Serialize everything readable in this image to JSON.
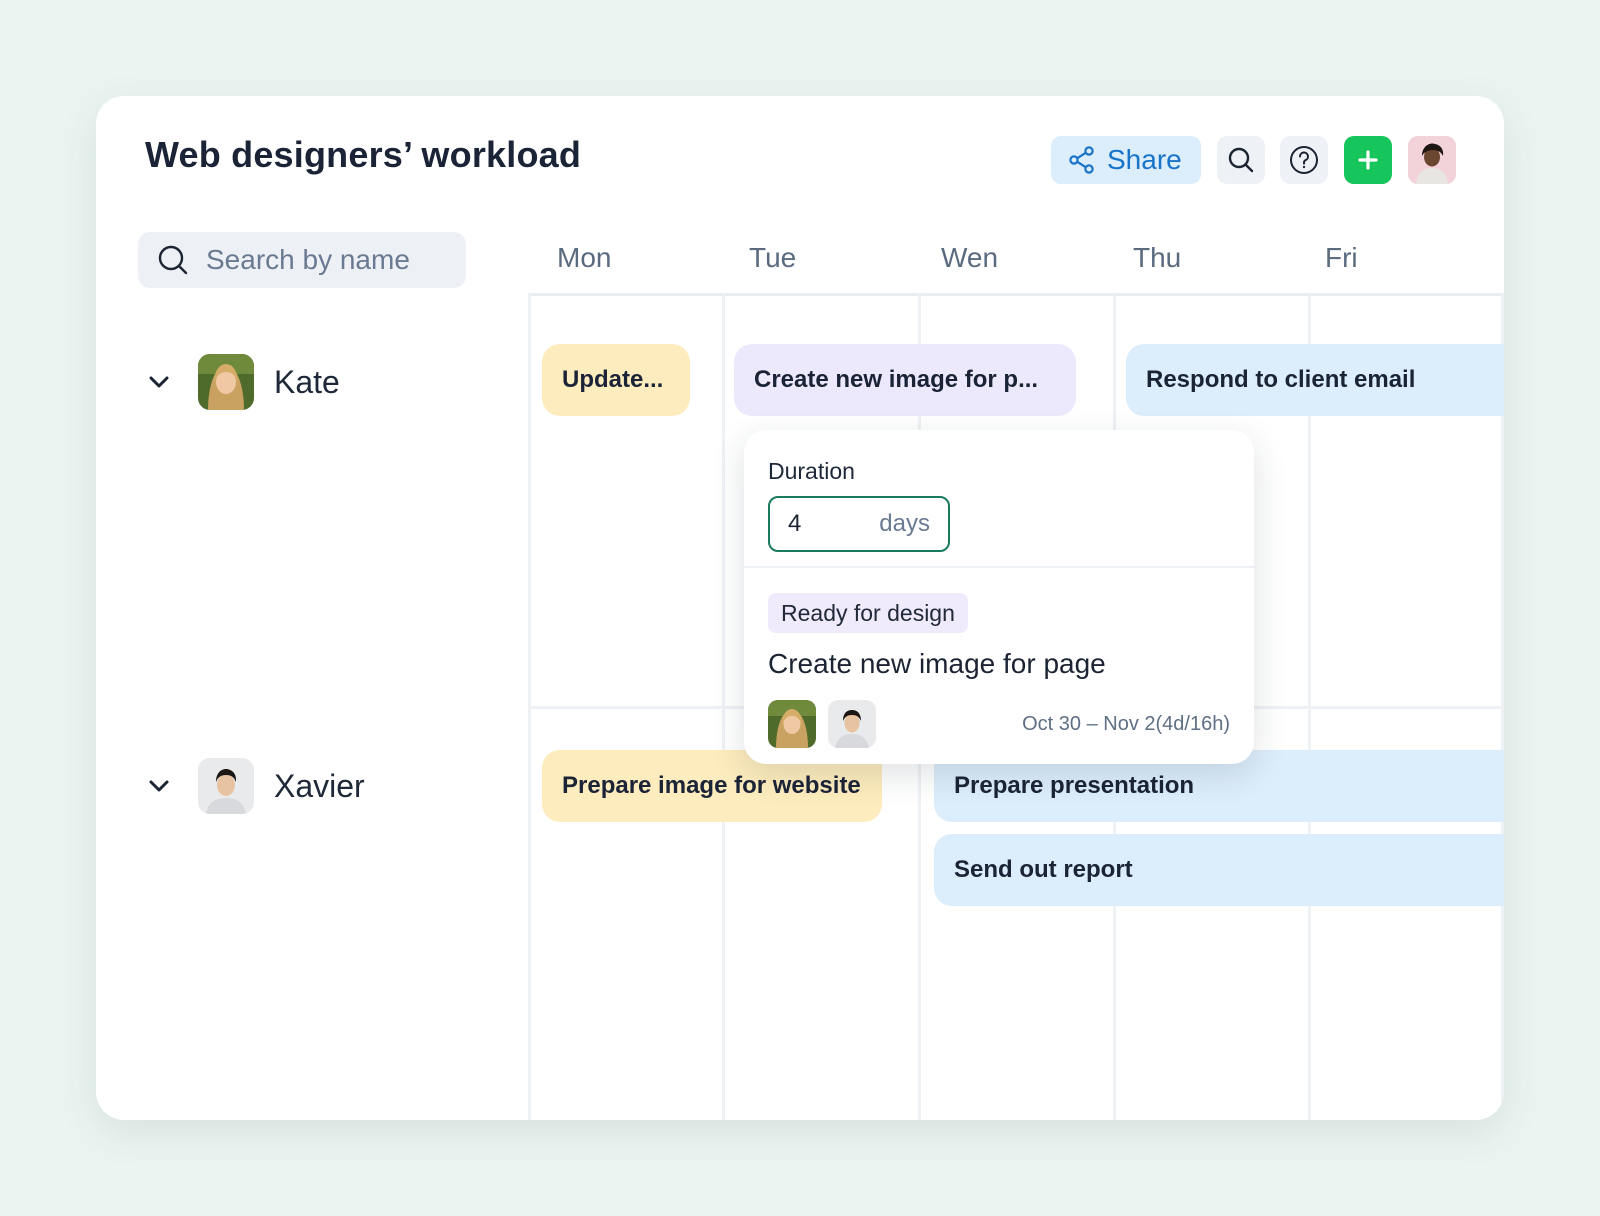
{
  "header": {
    "title": "Web designers’ workload",
    "share_label": "Share",
    "icons": [
      "share-icon",
      "search-icon",
      "help-icon",
      "plus-icon",
      "user-avatar"
    ]
  },
  "search": {
    "placeholder": "Search by name",
    "value": ""
  },
  "days": [
    "Mon",
    "Tue",
    "Wen",
    "Thu",
    "Fri"
  ],
  "people": [
    {
      "name": "Kate",
      "expanded": true
    },
    {
      "name": "Xavier",
      "expanded": true
    }
  ],
  "tasks": {
    "kate": [
      {
        "label": "Update...",
        "color": "#fdecbd"
      },
      {
        "label": "Create new image for p...",
        "color": "#ede9fc"
      },
      {
        "label": "Respond to client email",
        "color": "#dcedfb"
      }
    ],
    "xavier": [
      {
        "label": "Prepare image for website",
        "color": "#fdecbd"
      },
      {
        "label": "Prepare presentation",
        "color": "#dcedfb"
      },
      {
        "label": "Send out report",
        "color": "#dcedfb"
      }
    ]
  },
  "popup": {
    "duration_label": "Duration",
    "duration_value": "4",
    "duration_unit": "days",
    "status": "Ready for design",
    "task_title": "Create new image for page",
    "date_range": "Oct 30 – Nov 2(4d/16h)"
  },
  "colors": {
    "background": "#ebf4f1",
    "accent_blue": "#1874c9",
    "add_button": "#16c55c",
    "focus_border": "#1a7a5e"
  }
}
